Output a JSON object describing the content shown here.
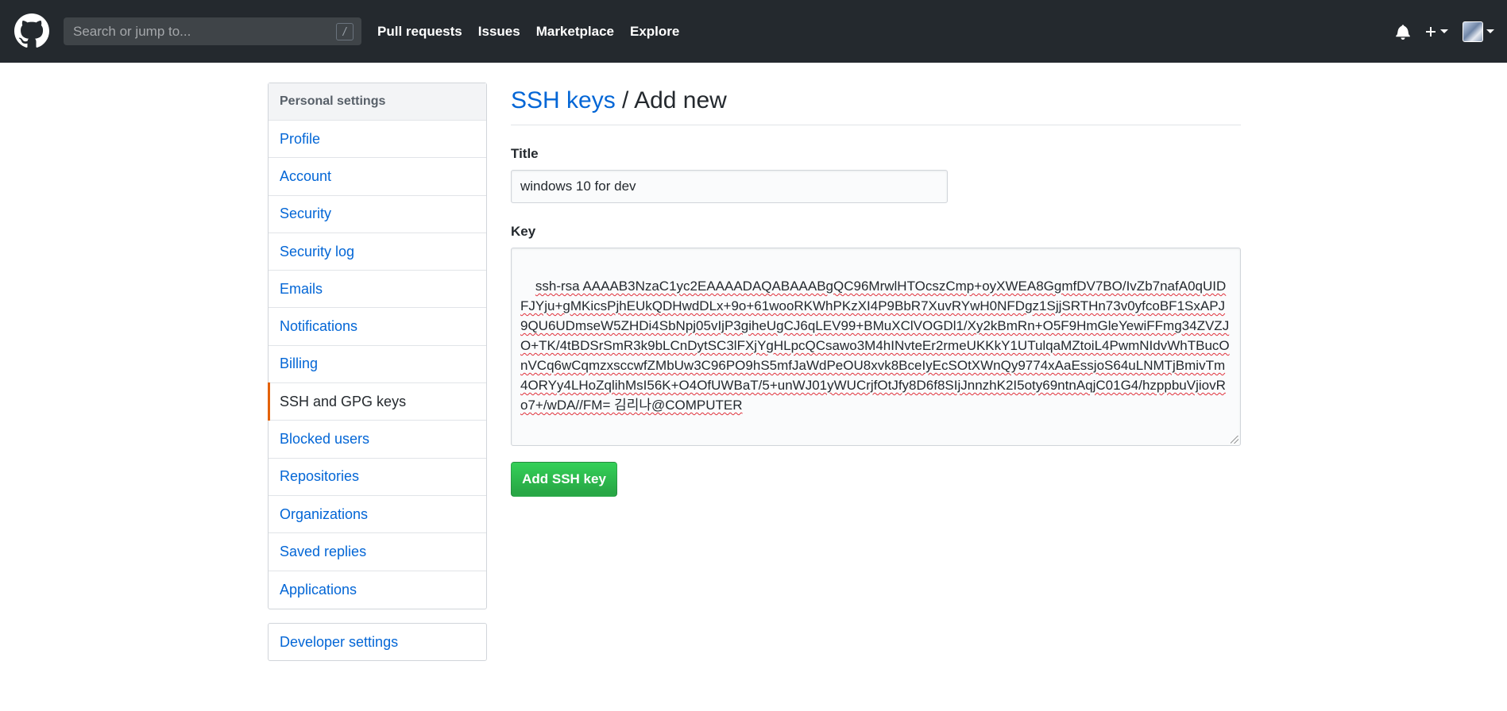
{
  "header": {
    "search_placeholder": "Search or jump to...",
    "search_shortcut": "/",
    "nav": [
      "Pull requests",
      "Issues",
      "Marketplace",
      "Explore"
    ]
  },
  "sidebar": {
    "header": "Personal settings",
    "items": [
      {
        "label": "Profile"
      },
      {
        "label": "Account"
      },
      {
        "label": "Security"
      },
      {
        "label": "Security log"
      },
      {
        "label": "Emails"
      },
      {
        "label": "Notifications"
      },
      {
        "label": "Billing"
      },
      {
        "label": "SSH and GPG keys",
        "selected": true
      },
      {
        "label": "Blocked users"
      },
      {
        "label": "Repositories"
      },
      {
        "label": "Organizations"
      },
      {
        "label": "Saved replies"
      },
      {
        "label": "Applications"
      }
    ],
    "developer_settings": "Developer settings"
  },
  "main": {
    "title_link": "SSH keys",
    "title_rest": " / Add new",
    "title_label": "Title",
    "title_value": "windows 10 for dev",
    "key_label": "Key",
    "key_value": "ssh-rsa AAAAB3NzaC1yc2EAAAADAQABAAABgQC96MrwlHTOcszCmp+oyXWEA8GgmfDV7BO/IvZb7nafA0qUIDFJYju+gMKicsPjhEUkQDHwdDLx+9o+61wooRKWhPKzXI4P9BbR7XuvRYwH0NFDgz1SjjSRTHn73v0yfcoBF1SxAPJ9QU6UDmseW5ZHDi4SbNpj05vIjP3giheUgCJ6qLEV99+BMuXClVOGDl1/Xy2kBmRn+O5F9HmGleYewiFFmg34ZVZJO+TK/4tBDSrSmR3k9bLCnDytSC3lFXjYgHLpcQCsawo3M4hINvteEr2rmeUKKkY1UTulqaMZtoiL4PwmNIdvWhTBucOnVCq6wCqmzxsccwfZMbUw3C96PO9hS5mfJaWdPeOU8xvk8BceIyEcSOtXWnQy9774xAaEssjoS64uLNMTjBmivTm4ORYy4LHoZqlihMsI56K+O4OfUWBaT/5+unWJ01yWUCrjfOtJfy8D6f8SIjJnnzhK2I5oty69ntnAqjC01G4/hzppbuVjiovRo7+/wDA//FM= 김리나@COMPUTER",
    "button_label": "Add SSH key"
  },
  "colors": {
    "header_bg": "#24292e",
    "link": "#0366d6",
    "selected_accent": "#e36209",
    "button_green": "#28a745"
  }
}
